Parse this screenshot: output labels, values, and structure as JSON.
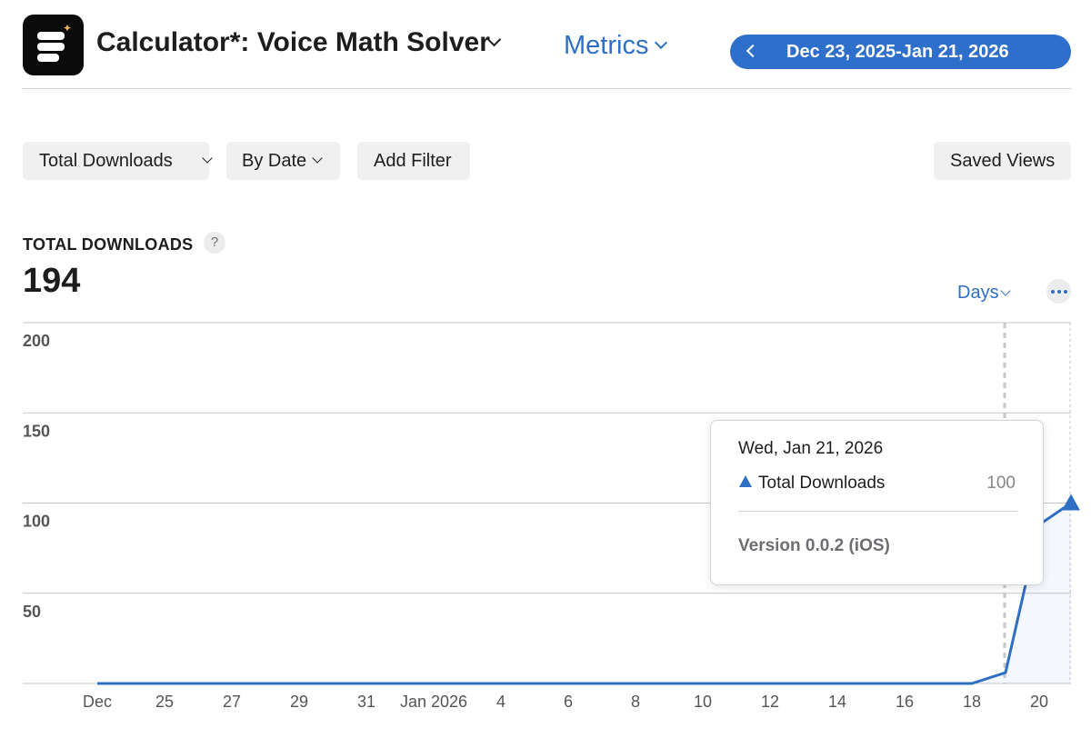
{
  "header": {
    "app_title": "Calculator*: Voice Math Solver",
    "metrics_label": "Metrics",
    "date_range": "Dec 23, 2025-Jan 21, 2026",
    "app_icon_name": "app-logo-icon"
  },
  "filters": {
    "measure_label": "Total Downloads",
    "group_label": "By Date",
    "add_filter_label": "Add Filter",
    "saved_views_label": "Saved Views"
  },
  "kpi": {
    "label": "TOTAL DOWNLOADS",
    "help_symbol": "?",
    "value": "194",
    "interval_label": "Days"
  },
  "tooltip": {
    "date": "Wed, Jan 21, 2026",
    "series_label": "Total Downloads",
    "value": "100",
    "note": "Version 0.0.2 (iOS)"
  },
  "colors": {
    "accent": "#2e6fc4",
    "date_pill": "#2d6fca",
    "grid": "#c7c7cc",
    "line": "#2e6fc4"
  },
  "chart_data": {
    "type": "line",
    "title": "",
    "xlabel": "",
    "ylabel": "",
    "ylim": [
      0,
      200
    ],
    "yticks": [
      50,
      100,
      150,
      200
    ],
    "x_tick_labels": [
      "Dec",
      "25",
      "27",
      "29",
      "31",
      "Jan 2026",
      "4",
      "6",
      "8",
      "10",
      "12",
      "14",
      "16",
      "18",
      "20"
    ],
    "series": [
      {
        "name": "Total Downloads",
        "x": [
          "2025-12-23",
          "2025-12-24",
          "2025-12-25",
          "2025-12-26",
          "2025-12-27",
          "2025-12-28",
          "2025-12-29",
          "2025-12-30",
          "2025-12-31",
          "2026-01-01",
          "2026-01-02",
          "2026-01-03",
          "2026-01-04",
          "2026-01-05",
          "2026-01-06",
          "2026-01-07",
          "2026-01-08",
          "2026-01-09",
          "2026-01-10",
          "2026-01-11",
          "2026-01-12",
          "2026-01-13",
          "2026-01-14",
          "2026-01-15",
          "2026-01-16",
          "2026-01-17",
          "2026-01-18",
          "2026-01-19",
          "2026-01-20",
          "2026-01-21"
        ],
        "values": [
          0,
          0,
          0,
          0,
          0,
          0,
          0,
          0,
          0,
          0,
          0,
          0,
          0,
          0,
          0,
          0,
          0,
          0,
          0,
          0,
          0,
          0,
          0,
          0,
          0,
          0,
          0,
          6,
          88,
          100
        ]
      }
    ],
    "highlight": {
      "x": "2026-01-21",
      "value": 100
    },
    "grid": true,
    "legend": "none"
  }
}
